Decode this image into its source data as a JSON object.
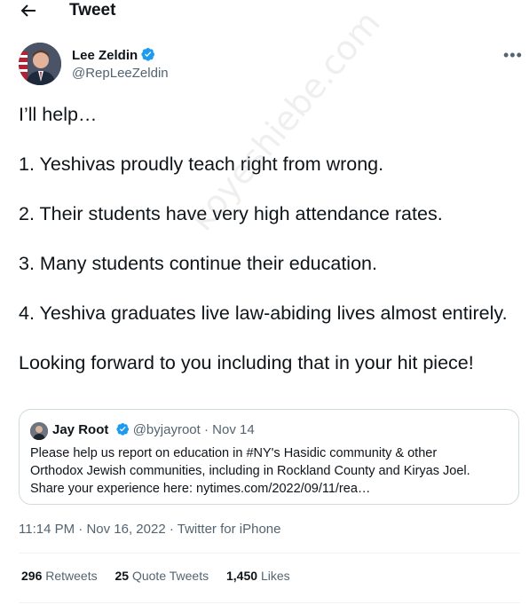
{
  "header": {
    "title": "Tweet",
    "back_icon": "back-arrow-icon"
  },
  "author": {
    "name": "Lee Zeldin",
    "handle": "@RepLeeZeldin",
    "verified_color": "#1d9bf0"
  },
  "tweet": {
    "paragraphs": [
      "I’ll help…",
      "1. Yeshivas proudly teach right from wrong.",
      "2. Their students have very high attendance rates.",
      "3. Many students continue their education.",
      "4. Yeshiva graduates live law-abiding lives almost entirely.",
      "Looking forward to you including that in your hit piece!"
    ]
  },
  "watermark": "koyeshiebe.com",
  "quote": {
    "name": "Jay Root",
    "handle": "@byjayroot",
    "separator": "·",
    "date": "Nov 14",
    "lines": [
      "Please help us report on education in #NY's Hasidic community & other",
      "Orthodox Jewish communities, including in  Rockland County and Kiryas Joel.",
      "Share your experience here: nytimes.com/2022/09/11/rea…"
    ]
  },
  "meta": {
    "time": "11:14 PM",
    "separator": "·",
    "date": "Nov 16, 2022",
    "source": "Twitter for iPhone"
  },
  "stats": {
    "retweets_count": "296",
    "retweets_label": "Retweets",
    "quotes_count": "25",
    "quotes_label": "Quote Tweets",
    "likes_count": "1,450",
    "likes_label": "Likes"
  }
}
